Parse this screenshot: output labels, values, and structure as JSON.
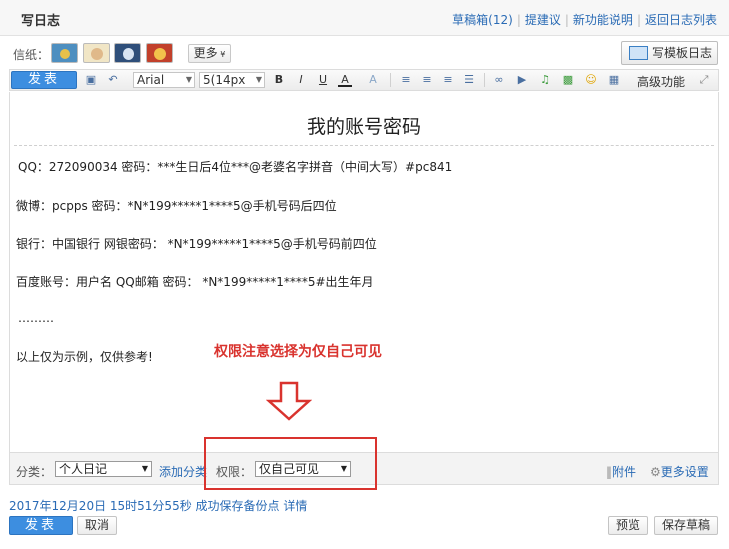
{
  "header": {
    "title": "写日志",
    "links": [
      "草稿箱(12)",
      "提建议",
      "新功能说明",
      "返回日志列表"
    ]
  },
  "paper": {
    "label": "信纸：",
    "more": "更多",
    "template_button": "写模板日志"
  },
  "toolbar": {
    "publish": "发表",
    "font": "Arial",
    "size": "5(14px",
    "advanced": "高级功能"
  },
  "editor": {
    "title": "我的账号密码",
    "lines": [
      "QQ：272090034 密码：***生日后4位***@老婆名字拼音（中间大写）#pc841",
      "微博：pcpps 密码：*N*199*****1****5@手机号码后四位",
      "银行：中国银行 网银密码： *N*199*****1****5@手机号码前四位",
      "百度账号：用户名 QQ邮箱 密码： *N*199*****1****5#出生年月",
      "………",
      "以上仅为示例，仅供参考!"
    ],
    "annotation": "权限注意选择为仅自己可见"
  },
  "category": {
    "label": "分类：",
    "value": "个人日记",
    "add": "添加分类",
    "permission_label": "权限：",
    "permission_value": "仅自己可见",
    "attachment": "附件",
    "more_settings": "更多设置"
  },
  "status_text": "2017年12月20日 15时51分55秒 成功保存备份点 详情",
  "footer": {
    "publish": "发表",
    "cancel": "取消",
    "preview": "预览",
    "save_draft": "保存草稿"
  },
  "colors": {
    "accent": "#3d8ee0",
    "link": "#2a6bb5",
    "annotation": "#d9332e"
  }
}
